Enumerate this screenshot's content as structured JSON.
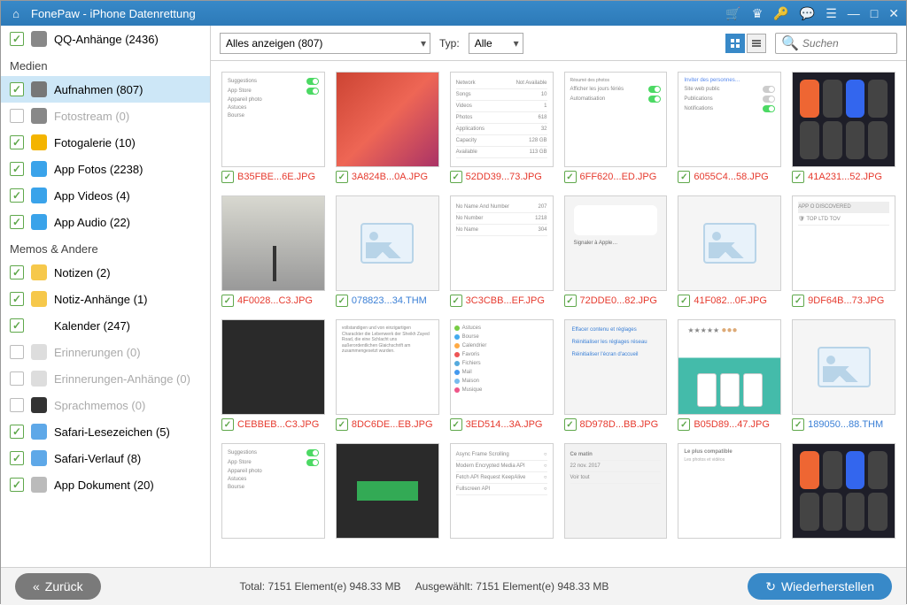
{
  "titlebar": {
    "title": "FonePaw - iPhone Datenrettung"
  },
  "sidebar": {
    "top_item": {
      "label": "QQ-Anhänge (2436)",
      "checked": true
    },
    "sections": [
      {
        "header": "Medien",
        "items": [
          {
            "label": "Aufnahmen (807)",
            "checked": true,
            "selected": true,
            "icon_bg": "#777"
          },
          {
            "label": "Fotostream (0)",
            "checked": false,
            "dim": true,
            "icon_bg": "#888"
          },
          {
            "label": "Fotogalerie (10)",
            "checked": true,
            "icon_bg": "#f4b400"
          },
          {
            "label": "App Fotos (2238)",
            "checked": true,
            "icon_bg": "#3aa3ea"
          },
          {
            "label": "App Videos (4)",
            "checked": true,
            "icon_bg": "#3aa3ea"
          },
          {
            "label": "App Audio (22)",
            "checked": true,
            "icon_bg": "#3aa3ea"
          }
        ]
      },
      {
        "header": "Memos & Andere",
        "items": [
          {
            "label": "Notizen (2)",
            "checked": true,
            "icon_bg": "#f6c84b"
          },
          {
            "label": "Notiz-Anhänge (1)",
            "checked": true,
            "icon_bg": "#f6c84b"
          },
          {
            "label": "Kalender (247)",
            "checked": true,
            "icon_bg": "#fff"
          },
          {
            "label": "Erinnerungen (0)",
            "checked": false,
            "dim": true,
            "icon_bg": "#ddd"
          },
          {
            "label": "Erinnerungen-Anhänge (0)",
            "checked": false,
            "dim": true,
            "icon_bg": "#ddd"
          },
          {
            "label": "Sprachmemos (0)",
            "checked": false,
            "dim": true,
            "icon_bg": "#333"
          },
          {
            "label": "Safari-Lesezeichen (5)",
            "checked": true,
            "icon_bg": "#5ea8e8"
          },
          {
            "label": "Safari-Verlauf (8)",
            "checked": true,
            "icon_bg": "#5ea8e8"
          },
          {
            "label": "App Dokument (20)",
            "checked": true,
            "icon_bg": "#bbb"
          }
        ]
      }
    ]
  },
  "toolbar": {
    "filter_value": "Alles anzeigen (807)",
    "type_label": "Typ:",
    "type_value": "Alle",
    "search_placeholder": "Suchen"
  },
  "grid": {
    "items": [
      {
        "filename": "B35FBE...6E.JPG",
        "color": "red",
        "thumb": "settings1"
      },
      {
        "filename": "3A824B...0A.JPG",
        "color": "red",
        "thumb": "red"
      },
      {
        "filename": "52DD39...73.JPG",
        "color": "red",
        "thumb": "list1"
      },
      {
        "filename": "6FF620...ED.JPG",
        "color": "red",
        "thumb": "settings2"
      },
      {
        "filename": "6055C4...58.JPG",
        "color": "red",
        "thumb": "settings3"
      },
      {
        "filename": "41A231...52.JPG",
        "color": "red",
        "thumb": "control"
      },
      {
        "filename": "4F0028...C3.JPG",
        "color": "red",
        "thumb": "landscape"
      },
      {
        "filename": "078823...34.THM",
        "color": "blue",
        "thumb": "placeholder"
      },
      {
        "filename": "3C3CBB...EF.JPG",
        "color": "red",
        "thumb": "list2"
      },
      {
        "filename": "72DDE0...82.JPG",
        "color": "red",
        "thumb": "card1"
      },
      {
        "filename": "41F082...0F.JPG",
        "color": "red",
        "thumb": "placeholder"
      },
      {
        "filename": "9DF64B...73.JPG",
        "color": "red",
        "thumb": "list3"
      },
      {
        "filename": "CEBBEB...C3.JPG",
        "color": "red",
        "thumb": "dark"
      },
      {
        "filename": "8DC6DE...EB.JPG",
        "color": "red",
        "thumb": "text"
      },
      {
        "filename": "3ED514...3A.JPG",
        "color": "red",
        "thumb": "cal"
      },
      {
        "filename": "8D978D...BB.JPG",
        "color": "red",
        "thumb": "card2"
      },
      {
        "filename": "B05D89...47.JPG",
        "color": "red",
        "thumb": "phones"
      },
      {
        "filename": "189050...88.THM",
        "color": "blue",
        "thumb": "placeholder"
      },
      {
        "filename": "",
        "color": "red",
        "thumb": "settings1",
        "nofoot": true
      },
      {
        "filename": "",
        "color": "red",
        "thumb": "dark2",
        "nofoot": true
      },
      {
        "filename": "",
        "color": "red",
        "thumb": "list4",
        "nofoot": true
      },
      {
        "filename": "",
        "color": "red",
        "thumb": "list5",
        "nofoot": true
      },
      {
        "filename": "",
        "color": "red",
        "thumb": "settings4",
        "nofoot": true
      },
      {
        "filename": "",
        "color": "red",
        "thumb": "control",
        "nofoot": true
      }
    ]
  },
  "bottombar": {
    "back_label": "Zurück",
    "total_label": "Total: 7151 Element(e) 948.33 MB",
    "selected_label": "Ausgewählt: 7151 Element(e) 948.33 MB",
    "recover_label": "Wiederherstellen"
  }
}
